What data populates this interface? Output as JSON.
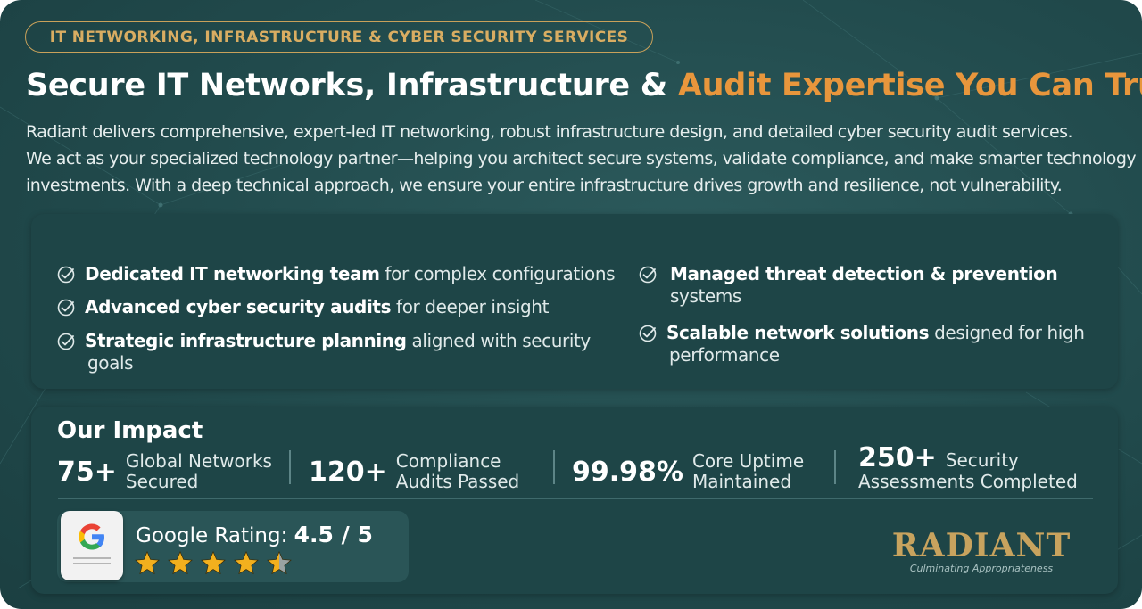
{
  "badge": "IT NETWORKING, INFRASTRUCTURE & CYBER SECURITY SERVICES",
  "headline": {
    "main": "Secure IT Networks, Infrastructure & ",
    "accent": "Audit Expertise You Can Trust."
  },
  "intro": [
    "Radiant delivers comprehensive, expert-led IT networking, robust infrastructure design, and detailed cyber security audit services.",
    "We act as your specialized technology partner—helping you architect secure systems, validate compliance, and make smarter technology",
    "investments. With a deep technical approach, we ensure your entire infrastructure drives growth and resilience, not vulnerability."
  ],
  "features": [
    {
      "bold": "Dedicated IT networking team",
      "rest": " for complex configurations",
      "rest2": ""
    },
    {
      "bold": "Advanced cyber security audits",
      "rest": " for deeper insight",
      "rest2": ""
    },
    {
      "bold": "Strategic infrastructure planning",
      "rest": " aligned with security",
      "rest2": "goals"
    },
    {
      "bold": "Managed threat detection & prevention",
      "rest": "",
      "rest2": "systems"
    },
    {
      "bold": "Scalable network solutions",
      "rest": " designed for high",
      "rest2": "performance"
    }
  ],
  "impact": {
    "title": "Our Impact",
    "stats": [
      {
        "value": "75+",
        "line1": "Global Networks",
        "line2": "Secured"
      },
      {
        "value": "120+",
        "line1": "Compliance",
        "line2": "Audits Passed"
      },
      {
        "value": "99.98%",
        "line1": "Core Uptime",
        "line2": "Maintained"
      },
      {
        "value": "250+",
        "line1": "Security",
        "line2": "Assessments Completed"
      }
    ]
  },
  "rating": {
    "label": "Google Rating: ",
    "value": "4.5 / 5",
    "stars": 4.5,
    "star_color": "#f2b01e",
    "icon": "google-g-icon"
  },
  "brand": {
    "name": "RADIANT",
    "tagline": "Culminating Appropriateness",
    "color": "#c8a35e"
  },
  "colors": {
    "background": "#214a4c",
    "panel": "#1e4547",
    "accent": "#e8963c",
    "gold": "#d9ad62"
  }
}
